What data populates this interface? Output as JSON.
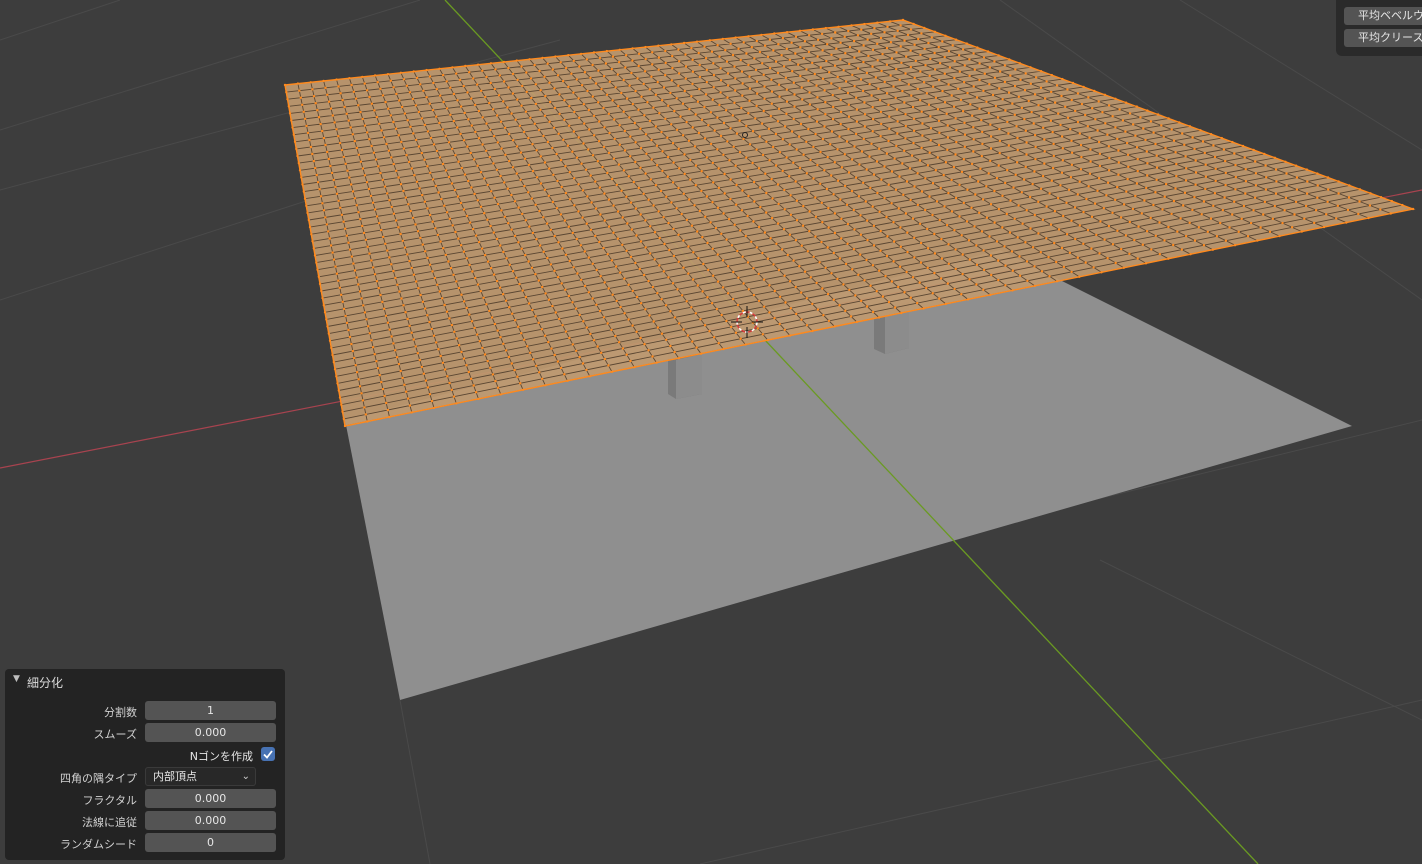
{
  "header_buttons": [
    {
      "label": "平均ベベルウェイト"
    },
    {
      "label": "平均クリース"
    }
  ],
  "operator_panel": {
    "title": "細分化",
    "cuts": {
      "label": "分割数",
      "value": "1"
    },
    "smoothness": {
      "label": "スムーズ",
      "value": "0.000"
    },
    "create_ngons": {
      "label": "Nゴンを作成",
      "checked": true
    },
    "quad_corner_type": {
      "label": "四角の隅タイプ",
      "value": "内部頂点"
    },
    "fractal": {
      "label": "フラクタル",
      "value": "0.000"
    },
    "along_normal": {
      "label": "法線に追従",
      "value": "0.000"
    },
    "random_seed": {
      "label": "ランダムシード",
      "value": "0"
    }
  },
  "colors": {
    "background": "#3d3d3d",
    "grid_line": "#4a4a4a",
    "x_axis": "#b04a58",
    "y_axis": "#6e9a2a",
    "mesh_face": "#c09a70",
    "mesh_edge": "#ff8a1e",
    "ground_plane": "#8e8e8e",
    "panel_bg": "#232323",
    "field_bg": "#545454",
    "checkbox_accent": "#4772b3"
  }
}
